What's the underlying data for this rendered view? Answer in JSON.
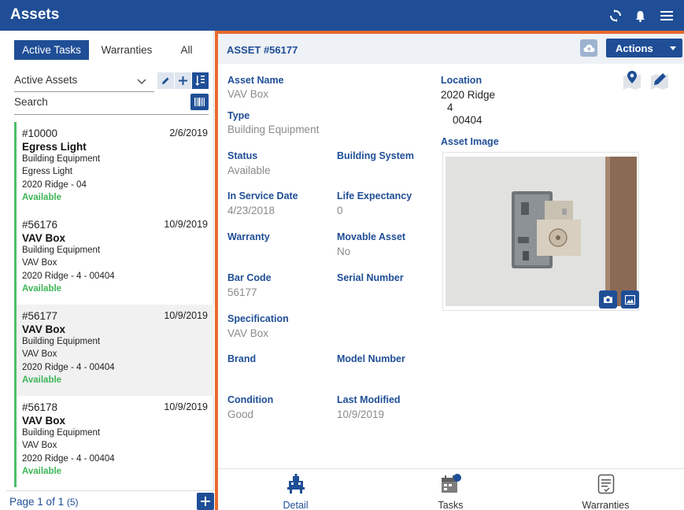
{
  "app": {
    "title": "Assets"
  },
  "left": {
    "tabs": [
      "Active Tasks",
      "Warranties",
      "All"
    ],
    "filter_label": "Active Assets",
    "search_placeholder": "Search",
    "items": [
      {
        "num": "#10000",
        "date": "2/6/2019",
        "name": "Egress Light",
        "line1": "Building Equipment",
        "line2": "Egress Light",
        "line3": "2020 Ridge - 04",
        "status": "Available"
      },
      {
        "num": "#56176",
        "date": "10/9/2019",
        "name": "VAV Box",
        "line1": "Building Equipment",
        "line2": "VAV Box",
        "line3": "2020 Ridge - 4 - 00404",
        "status": "Available"
      },
      {
        "num": "#56177",
        "date": "10/9/2019",
        "name": "VAV Box",
        "line1": "Building Equipment",
        "line2": "VAV Box",
        "line3": "2020 Ridge - 4 - 00404",
        "status": "Available"
      },
      {
        "num": "#56178",
        "date": "10/9/2019",
        "name": "VAV Box",
        "line1": "Building Equipment",
        "line2": "VAV Box",
        "line3": "2020 Ridge - 4 - 00404",
        "status": "Available"
      }
    ],
    "pager": {
      "prefix": "Page",
      "page": "1 of 1",
      "count": "(5)"
    }
  },
  "detail": {
    "asset_id": "ASSET #56177",
    "actions_label": "Actions",
    "fields": {
      "asset_name": {
        "label": "Asset Name",
        "value": "VAV Box"
      },
      "type": {
        "label": "Type",
        "value": "Building Equipment"
      },
      "status": {
        "label": "Status",
        "value": "Available"
      },
      "building_system": {
        "label": "Building System",
        "value": ""
      },
      "in_service_date": {
        "label": "In Service Date",
        "value": "4/23/2018"
      },
      "life_expectancy": {
        "label": "Life Expectancy",
        "value": "0"
      },
      "warranty": {
        "label": "Warranty",
        "value": ""
      },
      "movable_asset": {
        "label": "Movable Asset",
        "value": "No"
      },
      "bar_code": {
        "label": "Bar Code",
        "value": "56177"
      },
      "serial_number": {
        "label": "Serial Number",
        "value": ""
      },
      "specification": {
        "label": "Specification",
        "value": "VAV Box"
      },
      "brand": {
        "label": "Brand",
        "value": ""
      },
      "model_number": {
        "label": "Model Number",
        "value": ""
      },
      "condition": {
        "label": "Condition",
        "value": "Good"
      },
      "last_modified": {
        "label": "Last Modified",
        "value": "10/9/2019"
      }
    },
    "location": {
      "label": "Location",
      "line1": "2020 Ridge",
      "line2": "4",
      "line3": "00404"
    },
    "asset_image_label": "Asset Image"
  },
  "bottom_nav": [
    {
      "label": "Detail",
      "active": true
    },
    {
      "label": "Tasks",
      "active": false,
      "badge": ""
    },
    {
      "label": "Warranties",
      "active": false
    }
  ],
  "colors": {
    "brand": "#1f4e96",
    "accent": "#e86a2e",
    "available": "#3db557"
  }
}
